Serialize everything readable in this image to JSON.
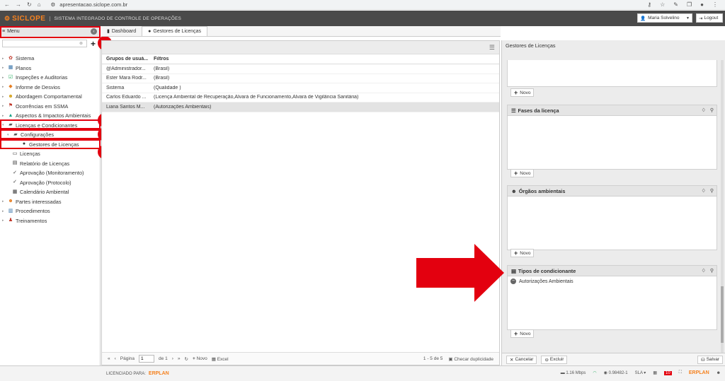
{
  "browser": {
    "url": "apresentacao.siclope.com.br"
  },
  "header": {
    "logo_text": "SICLOPE",
    "app_title": "SISTEMA INTEGRADO DE CONTROLE DE OPERAÇÕES",
    "user_name": "Maria Solvelino",
    "logout_label": "Logout"
  },
  "sidebar": {
    "menu_label": "Menu",
    "search_placeholder": "",
    "items": [
      {
        "label": "Sistema"
      },
      {
        "label": "Planos"
      },
      {
        "label": "Inspeções e Auditorias"
      },
      {
        "label": "Informe de Desvios"
      },
      {
        "label": "Abordagem Comportamental"
      },
      {
        "label": "Ocorrências em SSMA"
      },
      {
        "label": "Aspectos & Impactos Ambientais"
      },
      {
        "label": "Licenças e Condicionantes"
      },
      {
        "label": "Configurações"
      },
      {
        "label": "Gestores de Licenças"
      },
      {
        "label": "Licenças"
      },
      {
        "label": "Relatório de Licenças"
      },
      {
        "label": "Aprovação (Monitoramento)"
      },
      {
        "label": "Aprovação (Protocolo)"
      },
      {
        "label": "Calendário Ambiental"
      },
      {
        "label": "Partes interessadas"
      },
      {
        "label": "Procedimentos"
      },
      {
        "label": "Treinamentos"
      }
    ]
  },
  "annotations": [
    "1",
    "2",
    "3",
    "4"
  ],
  "tabs": [
    {
      "label": "Dashboard"
    },
    {
      "label": "Gestores de Licenças"
    }
  ],
  "grid": {
    "headers": [
      "Grupos de usuá...",
      "Filtros"
    ],
    "rows": [
      {
        "c1": "@Administrador...",
        "c2": "(Brasil)"
      },
      {
        "c1": "Ester Mara Rodr...",
        "c2": "(Brasil)"
      },
      {
        "c1": "Sistema",
        "c2": "(Qualidade )"
      },
      {
        "c1": "Carlos Eduardo ...",
        "c2": "(Licença Ambiental de Recuperação,Alvará de Funcionamento,Alvará de Vigilância Sanitária)"
      },
      {
        "c1": "Liana Santos M...",
        "c2": "(Autorizações Ambientais)"
      }
    ],
    "footer": {
      "page_label": "Página",
      "page_value": "1",
      "of_label": "de 1",
      "novo_label": "Novo",
      "excel_label": "Excel",
      "count": "1 - 5 de 5",
      "check_dup": "Checar duplicidade"
    }
  },
  "right_panel": {
    "title": "Gestores de Licenças",
    "novo_label": "Novo",
    "sections": [
      {
        "title": "Fases da licença"
      },
      {
        "title": "Órgãos ambientais"
      },
      {
        "title": "Tipos de condicionante",
        "items": [
          "Autorizações Ambientais"
        ]
      }
    ],
    "cancel_label": "Cancelar",
    "delete_label": "Excluir",
    "save_label": "Salvar"
  },
  "status_bar": {
    "licensed_label": "LICENCIADO PARA:",
    "erplan": "ERPLAN",
    "speed": "1.16 Mbps",
    "version": "0.98482-1",
    "sla": "SLA",
    "badge_count": "10"
  },
  "colors": {
    "accent": "#e3000f",
    "brand": "#f58220",
    "header_bg": "#4a4a4a"
  }
}
